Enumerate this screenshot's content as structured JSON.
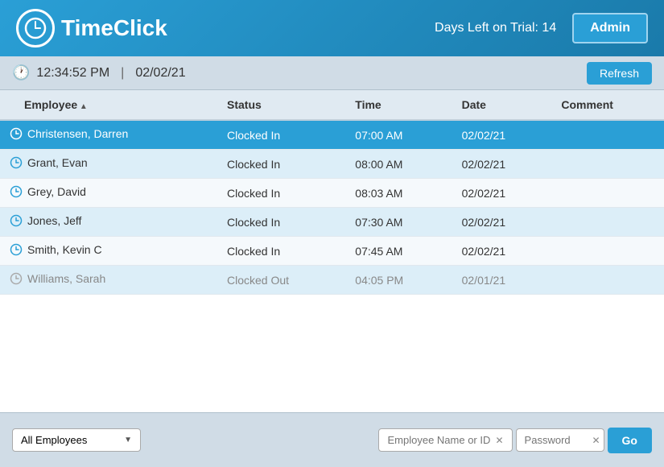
{
  "header": {
    "logo_text": "TimeClick",
    "trial_text": "Days Left on Trial: 14",
    "admin_label": "Admin"
  },
  "toolbar": {
    "time": "12:34:52 PM",
    "separator": "|",
    "date": "02/02/21",
    "refresh_label": "Refresh"
  },
  "table": {
    "columns": [
      {
        "key": "employee",
        "label": "Employee",
        "sortable": true,
        "sort": "asc"
      },
      {
        "key": "status",
        "label": "Status",
        "sortable": false
      },
      {
        "key": "time",
        "label": "Time",
        "sortable": false
      },
      {
        "key": "date",
        "label": "Date",
        "sortable": false
      },
      {
        "key": "comment",
        "label": "Comment",
        "sortable": false
      }
    ],
    "rows": [
      {
        "employee": "Christensen, Darren",
        "status": "Clocked In",
        "time": "07:00 AM",
        "date": "02/02/21",
        "comment": "",
        "selected": true,
        "dimmed": false
      },
      {
        "employee": "Grant, Evan",
        "status": "Clocked In",
        "time": "08:00 AM",
        "date": "02/02/21",
        "comment": "",
        "selected": false,
        "dimmed": false
      },
      {
        "employee": "Grey, David",
        "status": "Clocked In",
        "time": "08:03 AM",
        "date": "02/02/21",
        "comment": "",
        "selected": false,
        "dimmed": false
      },
      {
        "employee": "Jones, Jeff",
        "status": "Clocked In",
        "time": "07:30 AM",
        "date": "02/02/21",
        "comment": "",
        "selected": false,
        "dimmed": false
      },
      {
        "employee": "Smith, Kevin C",
        "status": "Clocked In",
        "time": "07:45 AM",
        "date": "02/02/21",
        "comment": "",
        "selected": false,
        "dimmed": false
      },
      {
        "employee": "Williams, Sarah",
        "status": "Clocked Out",
        "time": "04:05 PM",
        "date": "02/01/21",
        "comment": "",
        "selected": false,
        "dimmed": true
      }
    ]
  },
  "footer": {
    "dropdown_label": "All Employees",
    "dropdown_arrow": "▼",
    "employee_input_placeholder": "Employee Name or ID",
    "password_placeholder": "Password",
    "go_label": "Go"
  },
  "colors": {
    "accent": "#2a9fd6",
    "header_bg": "#1a7aaa",
    "selected_row": "#2a9fd6",
    "toolbar_bg": "#d0dce6"
  }
}
